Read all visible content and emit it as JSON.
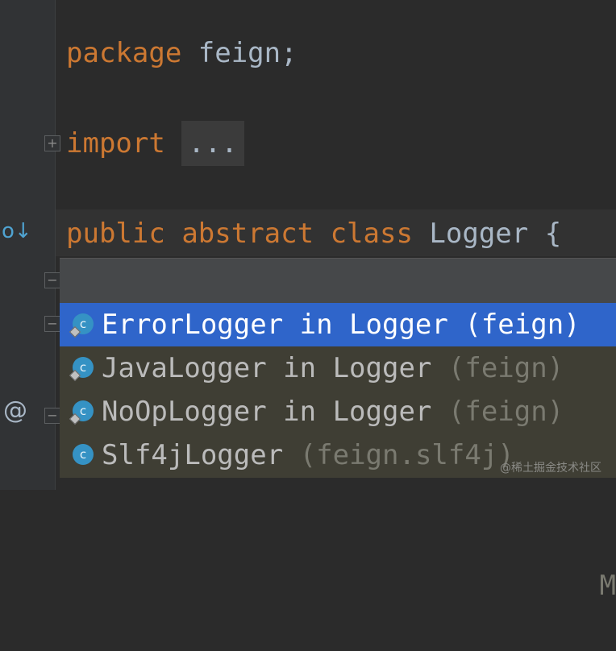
{
  "editor": {
    "line1": {
      "keyword": "package",
      "rest": " feign;"
    },
    "line2": {
      "keyword": "import",
      "folded": "..."
    },
    "line3": {
      "kw1": "public",
      "kw2": "abstract",
      "kw3": "class",
      "name": "Logger",
      "brace": "{"
    }
  },
  "gutter": {
    "fold_plus": "+",
    "fold_minus": "−",
    "implemented_icon": "o↓",
    "annotation_icon": "@"
  },
  "popup": {
    "items": [
      {
        "name": "ErrorLogger in Logger",
        "pkg": "(feign)",
        "icon": "c"
      },
      {
        "name": "JavaLogger in Logger",
        "pkg": "(feign)",
        "icon": "c"
      },
      {
        "name": "NoOpLogger in Logger",
        "pkg": "(feign)",
        "icon": "c"
      },
      {
        "name": "Slf4jLogger",
        "pkg": "(feign.slf4j)",
        "icon": "c",
        "trailing": "M"
      }
    ]
  },
  "watermark": "@稀土掘金技术社区",
  "colors": {
    "background": "#2b2b2b",
    "keyword": "#cc7832",
    "text": "#a9b7c6",
    "selection": "#2f65ca",
    "class_icon": "#3592c4"
  }
}
